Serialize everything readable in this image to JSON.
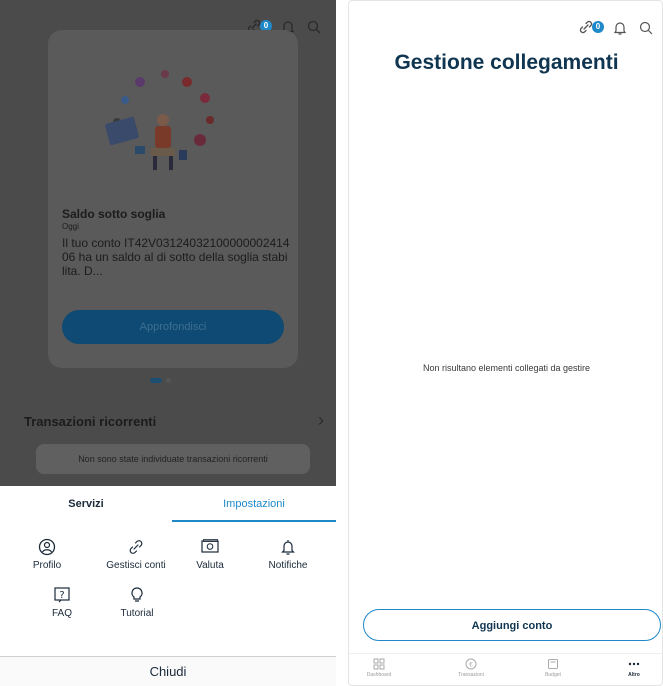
{
  "left": {
    "header": {
      "link_badge": "0"
    },
    "notification_card": {
      "title": "Saldo sotto soglia",
      "date": "Oggi",
      "body": "Il tuo conto IT42V0312403210000000241406 ha un saldo al di sotto della soglia stabilita. D...",
      "button_label": "Approfondisci"
    },
    "recurring": {
      "title": "Transazioni ricorrenti",
      "empty_text": "Non sono state individuate transazioni ricorrenti"
    },
    "sheet": {
      "tabs": [
        {
          "label": "Servizi",
          "active": false
        },
        {
          "label": "Impostazioni",
          "active": true
        }
      ],
      "items": [
        {
          "label": "Profilo",
          "icon": "profile-icon"
        },
        {
          "label": "Gestisci conti",
          "icon": "link-icon"
        },
        {
          "label": "Valuta",
          "icon": "currency-icon"
        },
        {
          "label": "Notifiche",
          "icon": "bell-icon"
        },
        {
          "label": "FAQ",
          "icon": "faq-icon"
        },
        {
          "label": "Tutorial",
          "icon": "lightbulb-icon"
        }
      ],
      "close_label": "Chiudi"
    }
  },
  "right": {
    "header": {
      "link_badge": "0"
    },
    "title": "Gestione collegamenti",
    "empty_message": "Non risultano elementi collegati da gestire",
    "add_button": "Aggiungi conto",
    "bottom_nav": [
      {
        "label": "Dashboard",
        "icon": "dashboard-icon",
        "active": false
      },
      {
        "label": "Transazioni",
        "icon": "euro-icon",
        "active": false
      },
      {
        "label": "Budget",
        "icon": "budget-icon",
        "active": false
      },
      {
        "label": "Altro",
        "icon": "more-icon",
        "active": true
      }
    ]
  },
  "colors": {
    "accent": "#1e88c8",
    "title": "#0f3550",
    "overlay": "#4b4b4b"
  }
}
